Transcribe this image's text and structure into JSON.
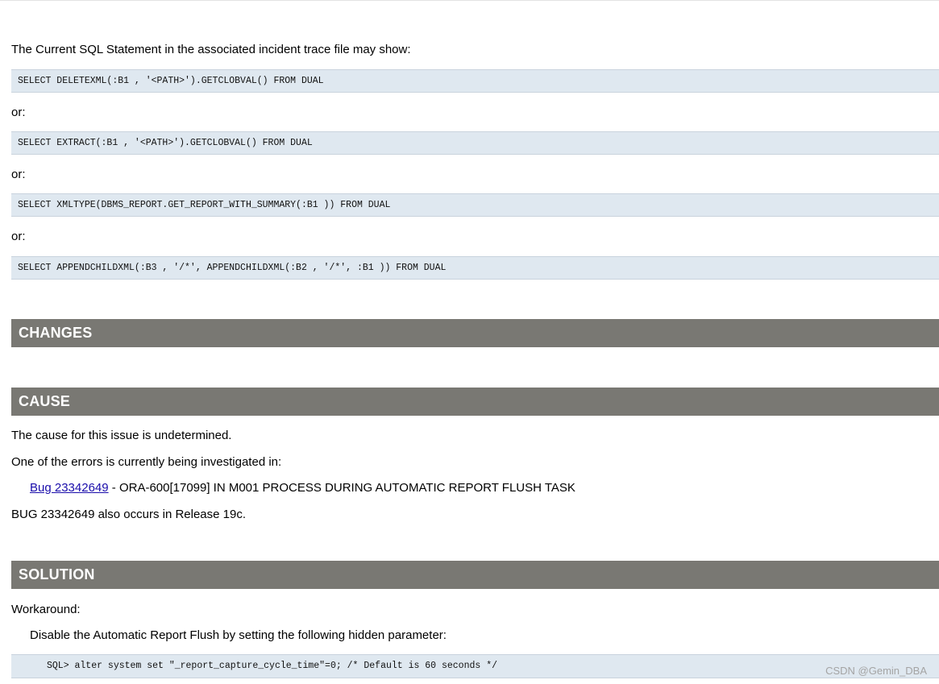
{
  "intro": {
    "text": "The Current SQL Statement in the associated incident trace file may show:"
  },
  "statements": [
    "SELECT DELETEXML(:B1 , '<PATH>').GETCLOBVAL() FROM DUAL",
    "SELECT EXTRACT(:B1 , '<PATH>').GETCLOBVAL() FROM DUAL",
    "SELECT XMLTYPE(DBMS_REPORT.GET_REPORT_WITH_SUMMARY(:B1 )) FROM DUAL",
    "SELECT APPENDCHILDXML(:B3 , '/*', APPENDCHILDXML(:B2 , '/*', :B1 )) FROM DUAL"
  ],
  "separators": [
    "or:",
    "or:",
    "or:"
  ],
  "changes": {
    "heading": "CHANGES"
  },
  "cause": {
    "heading": "CAUSE",
    "line1": "The cause for this issue is undetermined.",
    "line2": "One of the errors is currently being investigated in:",
    "bug_link": "Bug 23342649",
    "bug_desc": " - ORA-600[17099] IN M001 PROCESS DURING AUTOMATIC REPORT FLUSH TASK",
    "line3": "BUG 23342649 also occurs in Release 19c."
  },
  "solution": {
    "heading": "SOLUTION",
    "line1": "Workaround:",
    "line2": "Disable the Automatic Report Flush by setting the following hidden parameter:",
    "code": "SQL> alter system set \"_report_capture_cycle_time\"=0; /* Default is 60 seconds */"
  },
  "watermark": "CSDN @Gemin_DBA"
}
